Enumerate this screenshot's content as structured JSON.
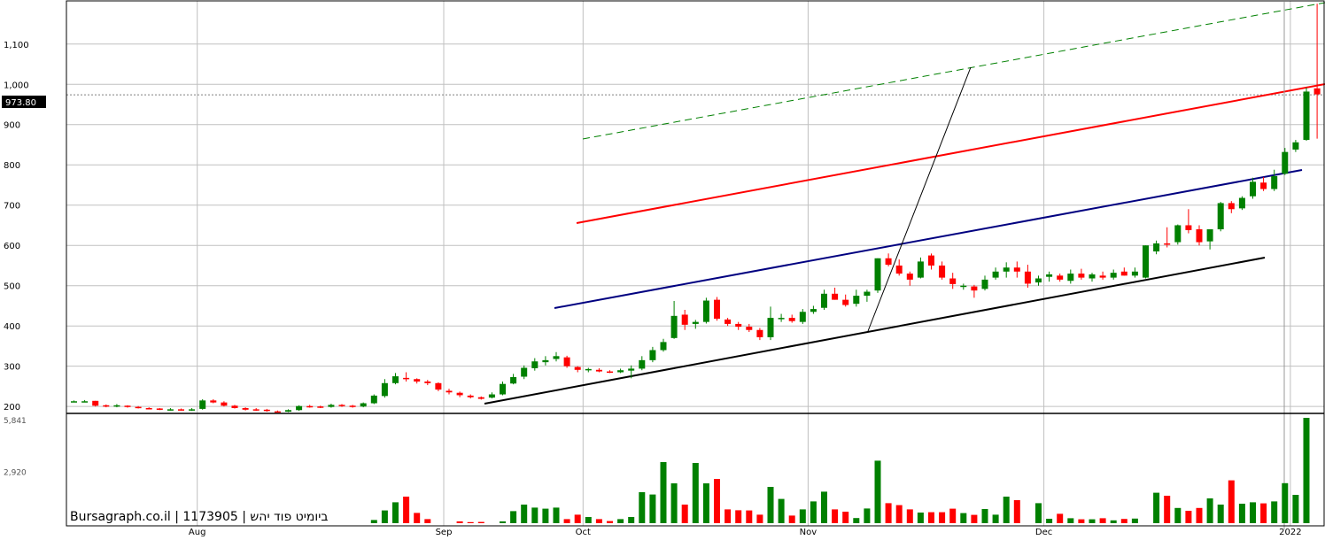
{
  "watermark": "Bursagraph.co.il | 1173905 | ביומיט פוד יהש",
  "price_tag": "973.80",
  "colors": {
    "up": "#008000",
    "down": "#ff0000",
    "grid": "#c0c0c0",
    "red_line": "#ff0000",
    "blue_line": "#000080",
    "black_line": "#000000",
    "green_dash": "#008000",
    "tag_bg": "#000000",
    "tag_fg": "#ffffff"
  },
  "chart_data": {
    "type": "candlestick",
    "price_axis": {
      "ylim": [
        185,
        1205
      ],
      "ticks": [
        200,
        300,
        400,
        500,
        600,
        700,
        800,
        900,
        1000,
        1100
      ],
      "tick_labels": [
        "200",
        "300",
        "400",
        "500",
        "600",
        "700",
        "800",
        "900",
        "1,000",
        "1,100"
      ]
    },
    "volume_axis": {
      "ylim": [
        0,
        6100
      ],
      "ticks": [
        2920,
        5841
      ],
      "tick_labels": [
        "2,920",
        "5,841"
      ]
    },
    "x_axis": {
      "bar_count": 113,
      "month_labels": [
        {
          "label": "Aug",
          "bar": 12
        },
        {
          "label": "Sep",
          "bar": 35
        },
        {
          "label": "Oct",
          "bar": 48
        },
        {
          "label": "Nov",
          "bar": 69
        },
        {
          "label": "Dec",
          "bar": 91
        },
        {
          "label": "2022",
          "bar": 114
        }
      ]
    },
    "last_price": 973.8,
    "reference_line": 973.8,
    "candles": [
      [
        213,
        215,
        211,
        213
      ],
      [
        213,
        216,
        211,
        213
      ],
      [
        214,
        214,
        200,
        202
      ],
      [
        203,
        205,
        198,
        201
      ],
      [
        201,
        206,
        198,
        203
      ],
      [
        202,
        203,
        197,
        199
      ],
      [
        199,
        201,
        195,
        197
      ],
      [
        196,
        198,
        193,
        195
      ],
      [
        195,
        196,
        191,
        193
      ],
      [
        193,
        196,
        190,
        193
      ],
      [
        193,
        195,
        190,
        192
      ],
      [
        192,
        196,
        189,
        193
      ],
      [
        194,
        218,
        192,
        215
      ],
      [
        215,
        218,
        208,
        210
      ],
      [
        210,
        213,
        200,
        202
      ],
      [
        202,
        204,
        195,
        196
      ],
      [
        196,
        198,
        190,
        192
      ],
      [
        193,
        196,
        189,
        192
      ],
      [
        192,
        194,
        187,
        190
      ],
      [
        188,
        190,
        185,
        187
      ],
      [
        187,
        193,
        186,
        191
      ],
      [
        191,
        203,
        189,
        201
      ],
      [
        201,
        204,
        197,
        200
      ],
      [
        200,
        202,
        196,
        199
      ],
      [
        199,
        207,
        197,
        204
      ],
      [
        204,
        206,
        199,
        201
      ],
      [
        202,
        204,
        197,
        199
      ],
      [
        200,
        210,
        198,
        208
      ],
      [
        208,
        230,
        206,
        227
      ],
      [
        226,
        268,
        222,
        258
      ],
      [
        258,
        283,
        255,
        275
      ],
      [
        271,
        285,
        262,
        268
      ],
      [
        268,
        270,
        257,
        262
      ],
      [
        262,
        266,
        253,
        258
      ],
      [
        258,
        260,
        238,
        242
      ],
      [
        239,
        244,
        230,
        235
      ],
      [
        234,
        237,
        223,
        228
      ],
      [
        227,
        230,
        220,
        223
      ],
      [
        223,
        225,
        217,
        219
      ],
      [
        222,
        235,
        220,
        230
      ],
      [
        230,
        262,
        228,
        256
      ],
      [
        257,
        281,
        255,
        273
      ],
      [
        274,
        302,
        268,
        296
      ],
      [
        295,
        320,
        289,
        312
      ],
      [
        310,
        325,
        302,
        315
      ],
      [
        318,
        335,
        312,
        325
      ],
      [
        322,
        326,
        296,
        300
      ],
      [
        298,
        300,
        285,
        291
      ],
      [
        290,
        296,
        285,
        293
      ],
      [
        291,
        295,
        285,
        287
      ],
      [
        287,
        290,
        283,
        285
      ],
      [
        285,
        294,
        283,
        290
      ],
      [
        289,
        302,
        270,
        294
      ],
      [
        294,
        325,
        290,
        315
      ],
      [
        315,
        348,
        310,
        340
      ],
      [
        340,
        368,
        336,
        360
      ],
      [
        370,
        462,
        368,
        425
      ],
      [
        428,
        440,
        390,
        403
      ],
      [
        405,
        415,
        393,
        410
      ],
      [
        410,
        470,
        406,
        463
      ],
      [
        465,
        472,
        413,
        418
      ],
      [
        416,
        420,
        400,
        405
      ],
      [
        405,
        410,
        390,
        398
      ],
      [
        398,
        405,
        385,
        390
      ],
      [
        390,
        395,
        365,
        372
      ],
      [
        372,
        448,
        365,
        420
      ],
      [
        420,
        430,
        410,
        420
      ],
      [
        420,
        428,
        408,
        412
      ],
      [
        410,
        442,
        405,
        435
      ],
      [
        435,
        450,
        430,
        442
      ],
      [
        445,
        490,
        440,
        480
      ],
      [
        480,
        495,
        465,
        465
      ],
      [
        465,
        478,
        448,
        452
      ],
      [
        455,
        490,
        448,
        475
      ],
      [
        475,
        490,
        460,
        485
      ],
      [
        488,
        568,
        482,
        568
      ],
      [
        568,
        580,
        548,
        552
      ],
      [
        550,
        565,
        525,
        530
      ],
      [
        530,
        535,
        500,
        515
      ],
      [
        520,
        570,
        518,
        560
      ],
      [
        575,
        580,
        540,
        550
      ],
      [
        550,
        560,
        515,
        520
      ],
      [
        518,
        532,
        492,
        504
      ],
      [
        500,
        505,
        490,
        500
      ],
      [
        498,
        502,
        470,
        488
      ],
      [
        492,
        525,
        488,
        515
      ],
      [
        520,
        545,
        515,
        535
      ],
      [
        535,
        558,
        520,
        545
      ],
      [
        545,
        560,
        520,
        535
      ],
      [
        535,
        552,
        495,
        505
      ],
      [
        508,
        525,
        500,
        518
      ],
      [
        522,
        535,
        510,
        528
      ],
      [
        525,
        530,
        510,
        515
      ],
      [
        512,
        540,
        505,
        530
      ],
      [
        530,
        542,
        515,
        520
      ],
      [
        518,
        532,
        510,
        528
      ],
      [
        525,
        535,
        515,
        520
      ],
      [
        520,
        540,
        515,
        532
      ],
      [
        535,
        545,
        525,
        525
      ],
      [
        525,
        545,
        520,
        535
      ],
      [
        520,
        600,
        518,
        600
      ],
      [
        585,
        612,
        578,
        605
      ],
      [
        605,
        645,
        595,
        602
      ],
      [
        608,
        652,
        602,
        650
      ],
      [
        650,
        690,
        630,
        638
      ],
      [
        640,
        650,
        600,
        608
      ],
      [
        610,
        640,
        590,
        640
      ],
      [
        640,
        708,
        635,
        705
      ],
      [
        705,
        710,
        680,
        690
      ],
      [
        692,
        722,
        688,
        718
      ],
      [
        722,
        768,
        716,
        758
      ],
      [
        756,
        770,
        735,
        740
      ],
      [
        740,
        788,
        735,
        772
      ],
      [
        778,
        842,
        775,
        832
      ],
      [
        838,
        862,
        832,
        856
      ],
      [
        862,
        992,
        860,
        982
      ],
      [
        990,
        1200,
        865,
        975
      ]
    ],
    "volumes": [
      0,
      0,
      0,
      0,
      0,
      0,
      0,
      0,
      0,
      0,
      0,
      0,
      0,
      0,
      0,
      0,
      0,
      0,
      0,
      0,
      0,
      0,
      0,
      0,
      0,
      0,
      0,
      0,
      180,
      720,
      1180,
      1500,
      580,
      230,
      0,
      0,
      100,
      60,
      70,
      0,
      100,
      680,
      1050,
      880,
      820,
      880,
      230,
      480,
      350,
      230,
      120,
      230,
      350,
      1750,
      1620,
      3450,
      2250,
      1050,
      3400,
      2250,
      2500,
      780,
      730,
      720,
      480,
      2050,
      1370,
      430,
      780,
      1230,
      1780,
      780,
      650,
      290,
      830,
      3530,
      1130,
      1020,
      780,
      600,
      620,
      620,
      820,
      570,
      470,
      800,
      480,
      1500,
      1300,
      0,
      1130,
      250,
      530,
      280,
      220,
      220,
      280,
      160,
      240,
      260,
      0,
      1720,
      1550,
      860,
      700,
      860,
      1400,
      1050,
      2420,
      1100,
      1180,
      1120,
      1230,
      2260,
      1600,
      5950
    ]
  }
}
